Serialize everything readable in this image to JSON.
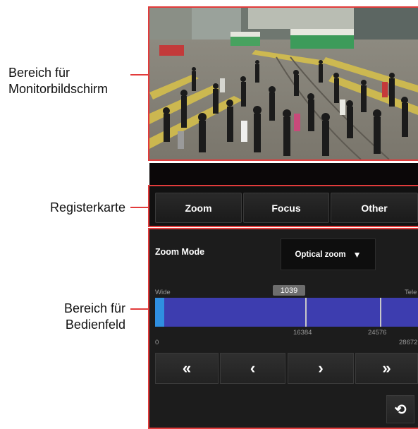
{
  "annotations": {
    "monitor": [
      "Bereich für",
      "Monitorbildschirm"
    ],
    "tabs": "Registerkarte",
    "panel": [
      "Bereich für",
      "Bedienfeld"
    ]
  },
  "tabs": [
    {
      "label": "Zoom",
      "selected": true
    },
    {
      "label": "Focus",
      "selected": false
    },
    {
      "label": "Other",
      "selected": false
    }
  ],
  "zoom_panel": {
    "mode_label": "Zoom Mode",
    "mode_value": "Optical zoom",
    "wide_label": "Wide",
    "tele_label": "Tele",
    "current_position": "1039",
    "scale": {
      "min": "0",
      "mark1": "16384",
      "mark2": "24576",
      "max": "28672"
    },
    "buttons": {
      "fast_wide": "«",
      "wide": "‹",
      "tele": "›",
      "fast_tele": "»"
    },
    "refresh_icon": "refresh-icon"
  },
  "colors": {
    "annotation_red": "#e23b3b",
    "zoom_bar": "#3d3daf",
    "zoom_knob": "#2f8fe0"
  }
}
